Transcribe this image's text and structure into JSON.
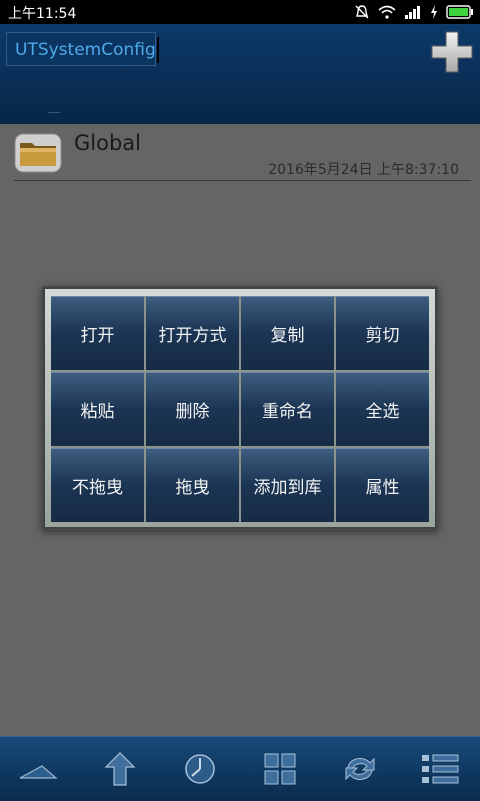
{
  "status": {
    "time": "上午11:54"
  },
  "header": {
    "path": "UTSystemConfig"
  },
  "files": [
    {
      "name": "Global",
      "date": "2016年5月24日 上午8:37:10"
    }
  ],
  "menu": {
    "items": [
      "打开",
      "打开方式",
      "复制",
      "剪切",
      "粘贴",
      "删除",
      "重命名",
      "全选",
      "不拖曳",
      "拖曳",
      "添加到库",
      "属性"
    ]
  },
  "colors": {
    "header": "#0a2f57",
    "menu_button": "#1c3554",
    "background": "#666666"
  },
  "icons": {
    "header": "plus-icon",
    "toolbar": [
      "triangle-icon",
      "up-arrow-icon",
      "clock-icon",
      "grid-icon",
      "refresh-icon",
      "list-menu-icon"
    ]
  }
}
